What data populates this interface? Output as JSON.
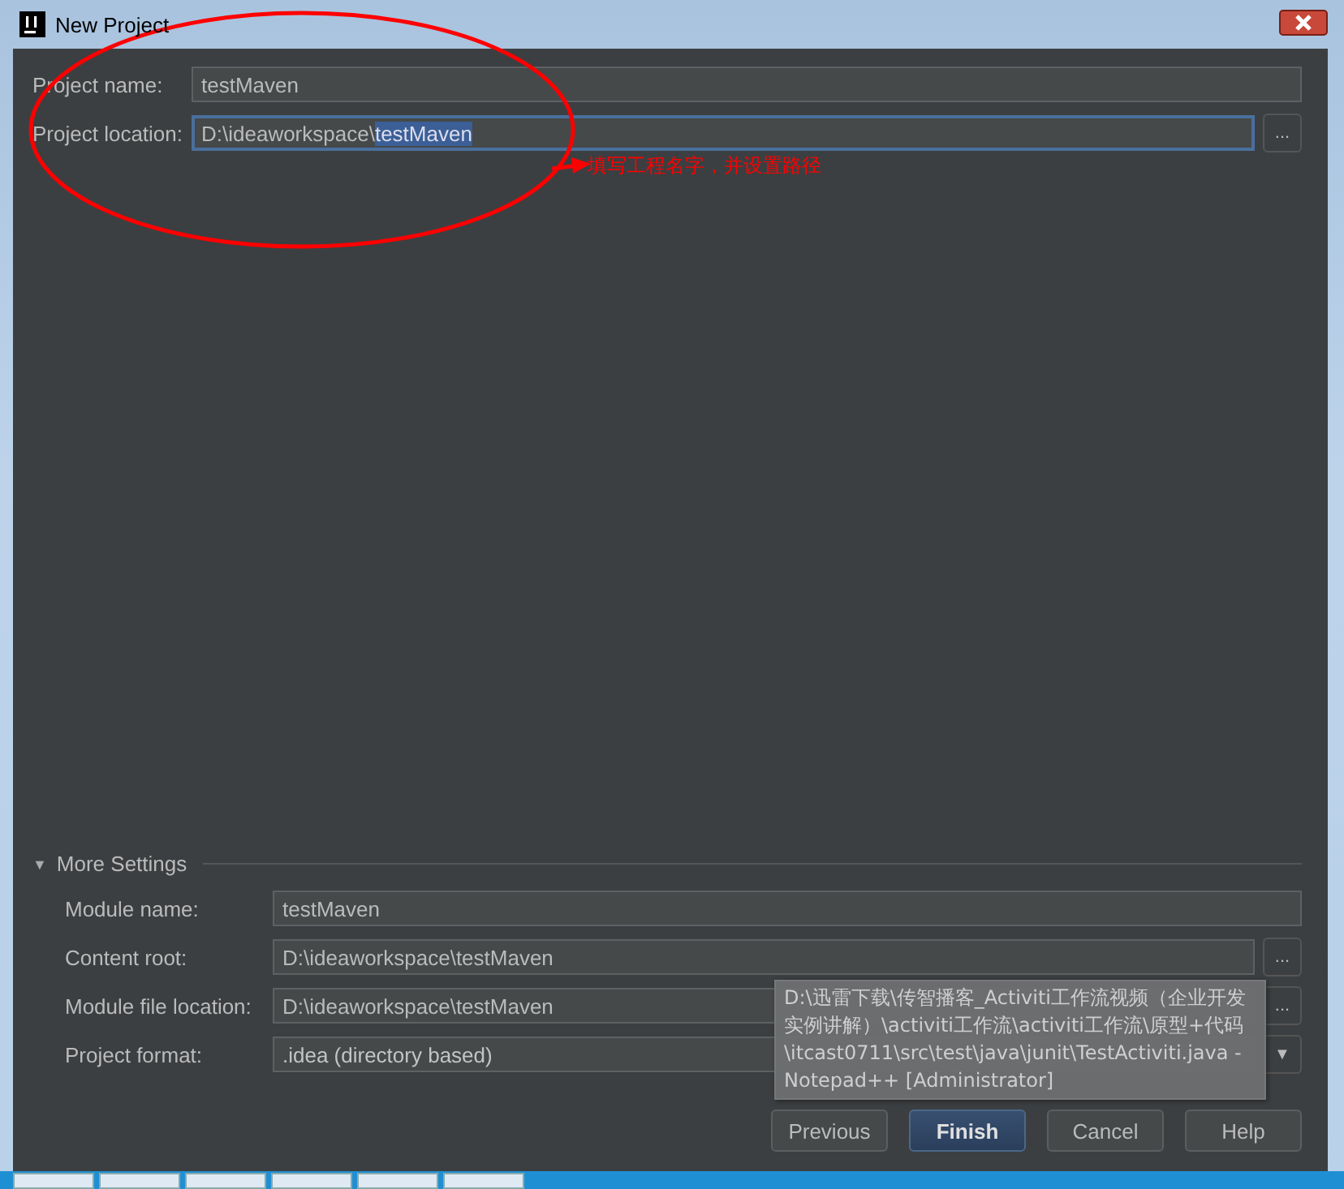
{
  "window": {
    "title": "New Project"
  },
  "project_fields": [
    {
      "label": "Project name:",
      "value": "testMaven",
      "focused": false
    },
    {
      "label": "Project location:",
      "value": "D:\\ideaworkspace\\",
      "selected_text": "testMaven",
      "focused": true,
      "browse": "..."
    }
  ],
  "more_settings": {
    "label": "More Settings",
    "expanded": true,
    "toggle": "▼",
    "fields": [
      {
        "kind": "text",
        "label": "Module name:",
        "value": "testMaven"
      },
      {
        "kind": "browse",
        "label": "Content root:",
        "value": "D:\\ideaworkspace\\testMaven",
        "button": "..."
      },
      {
        "kind": "browse",
        "label": "Module file location:",
        "value": "D:\\ideaworkspace\\testMaven",
        "button": "..."
      },
      {
        "kind": "dropdown",
        "label": "Project format:",
        "value": ".idea (directory based)",
        "button": "▼"
      }
    ]
  },
  "buttons": [
    {
      "label": "Previous",
      "default": false
    },
    {
      "label": "Finish",
      "default": true
    },
    {
      "label": "Cancel",
      "default": false
    },
    {
      "label": "Help",
      "default": false
    }
  ],
  "annotation": {
    "text": "填写工程名字，并设置路径"
  },
  "tooltip": {
    "text": "D:\\迅雷下载\\传智播客_Activiti工作流视频（企业开发实例讲解）\\activiti工作流\\activiti工作流\\原型+代码\\itcast0711\\src\\test\\java\\junit\\TestActiviti.java - Notepad++ [Administrator]"
  }
}
